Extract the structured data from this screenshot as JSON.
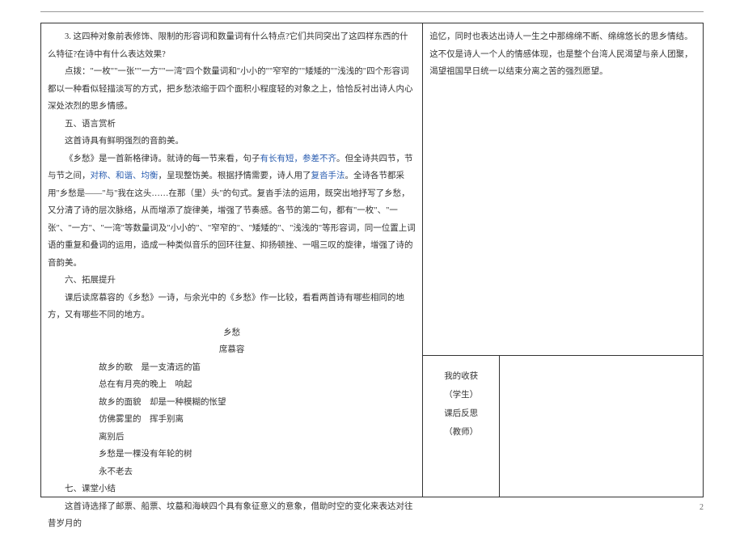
{
  "left": {
    "q3": "3. 这四种对象前表修饰、限制的形容词和数量词有什么特点?它们共同突出了这四样东西的什么特征?在诗中有什么表达效果?",
    "tip": "点拨：\"一枚\"\"一张\"\"一方\"\"一湾\"四个数量词和\"小小的\"\"窄窄的\"\"矮矮的\"\"浅浅的\"四个形容词都以一种看似轻描淡写的方式，把乡愁浓缩于四个面积小程度轻的对象之上，恰恰反衬出诗人内心深处浓烈的思乡情感。",
    "h5": "五、语言赏析",
    "p5a": "这首诗具有鲜明强烈的音韵美。",
    "p5b_pre": "《乡愁》是一首新格律诗。就诗的每一节来看，句子",
    "p5b_blue1": "有长有短，参差不齐",
    "p5b_mid1": "。但全诗共四节，节与节之间，",
    "p5b_blue2": "对称、和谐、均衡",
    "p5b_mid2": "，呈现整饬美。根据抒情需要，诗人用了",
    "p5b_blue3": "复沓手法",
    "p5b_post": "。全诗各节都采用\"乡愁是——\"与\"我在这头……在那（里）头\"的句式。复沓手法的运用，既突出地抒写了乡愁，又分清了诗的层次脉络，从而增添了旋律美，增强了节奏感。各节的第二句，都有\"一枚\"、\"一张\"、\"一方\"、\"一湾\"等数量词及\"小小的\"、\"窄窄的\"、\"矮矮的\"、\"浅浅的\"等形容词，同一位置上词语的重复和叠词的运用，造成一种类似音乐的回环往复、抑扬顿挫、一唱三叹的旋律，增强了诗的音韵美。",
    "h6": "六、拓展提升",
    "p6": "课后读席慕容的《乡愁》一诗，与余光中的《乡愁》作一比较，看看两首诗有哪些相同的地方，又有哪些不同的地方。",
    "poem_title": "乡愁",
    "poem_author": "席慕容",
    "poem_l1": "故乡的歌　是一支清远的笛",
    "poem_l2": "总在有月亮的晚上　响起",
    "poem_l3": "故乡的面貌　却是一种模糊的怅望",
    "poem_l4": "仿佛雾里的　挥手别离",
    "poem_l5": "离别后",
    "poem_l6": "乡愁是一棵没有年轮的树",
    "poem_l7": "永不老去",
    "h7": "七、课堂小结",
    "p7": "这首诗选择了邮票、船票、坟墓和海峡四个具有象征意义的意象，借助时空的变化来表达对往昔岁月的"
  },
  "right_top": {
    "text": "追忆，同时也表达出诗人一生之中那绵绵不断、绵绵悠长的思乡情结。这不仅是诗人一个人的情感体现，也是整个台湾人民渴望与亲人团聚，渴望祖国早日统一以结束分离之苦的强烈愿望。"
  },
  "right_bottom": {
    "row1": "我的收获",
    "row2": "（学生）",
    "row3": "课后反思",
    "row4": "（教师）"
  },
  "page_number": "2"
}
